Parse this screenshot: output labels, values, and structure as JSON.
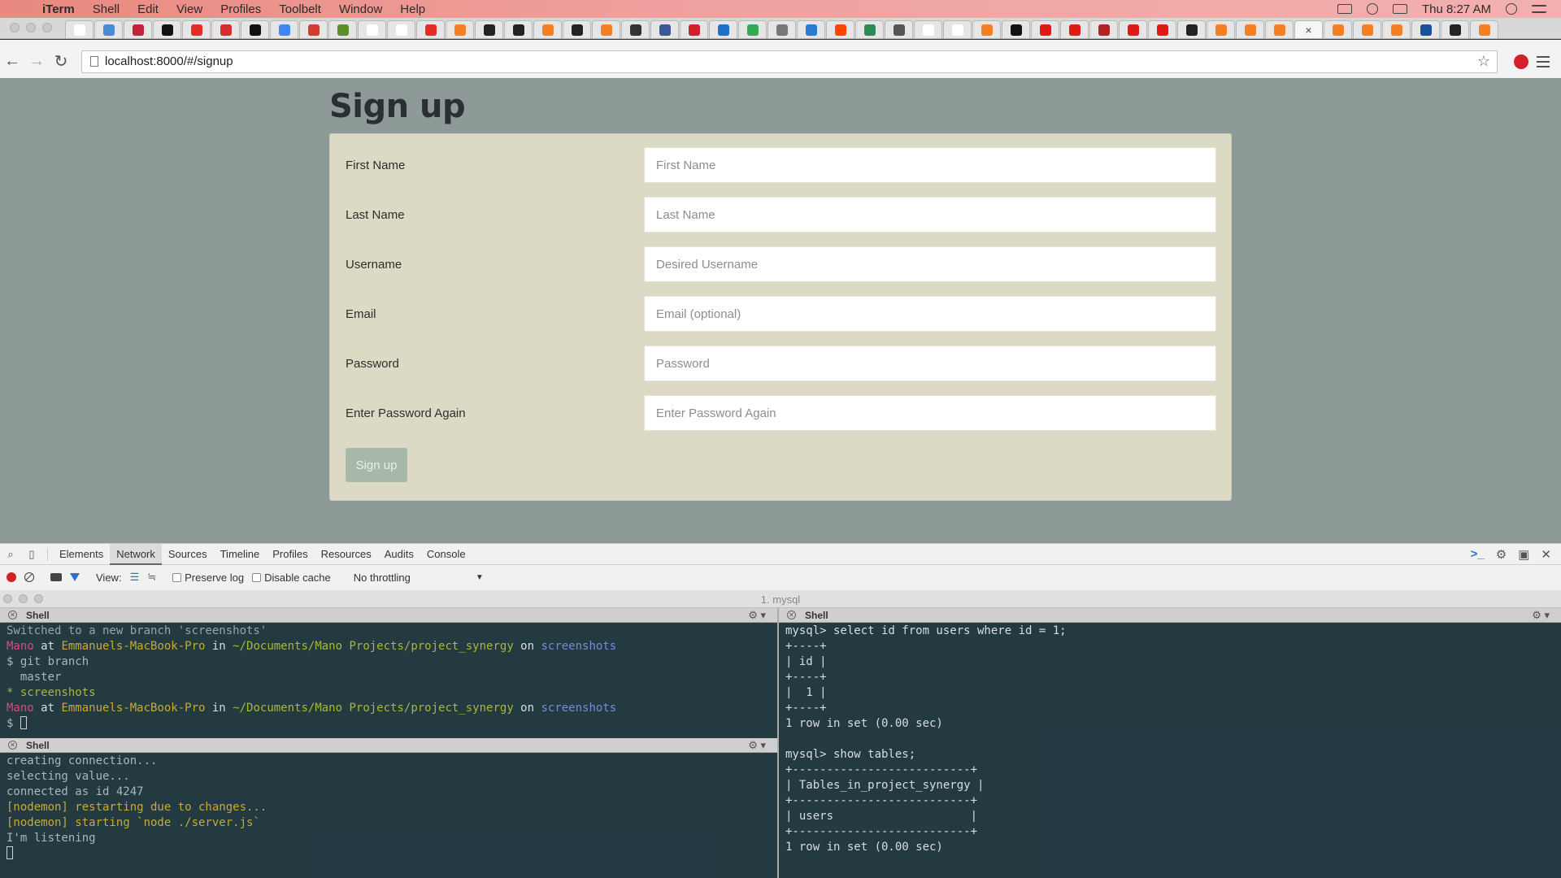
{
  "menubar": {
    "app_name": "iTerm",
    "items": [
      "Shell",
      "Edit",
      "View",
      "Profiles",
      "Toolbelt",
      "Window",
      "Help"
    ],
    "clock": "Thu 8:27 AM"
  },
  "browser": {
    "url": "localhost:8000/#/signup",
    "tab_colors": [
      "#ffffff",
      "#4a8bd6",
      "#c2233a",
      "#111111",
      "#e52d27",
      "#d32f2f",
      "#111111",
      "#4285f4",
      "#d23b2f",
      "#5c8f2c",
      "#ffffff",
      "#ffffff",
      "#e52d27",
      "#f48024",
      "#222222",
      "#222222",
      "#f48024",
      "#222222",
      "#f48024",
      "#333333",
      "#3b5998",
      "#d0202a",
      "#1e70c8",
      "#34a853",
      "#777777",
      "#2a7bd1",
      "#ff4500",
      "#2e8b57",
      "#555555",
      "#ffffff",
      "#ffffff",
      "#f48024",
      "#111111",
      "#dd1b16",
      "#dd1b16",
      "#b22222",
      "#dd1b16",
      "#dd1b16",
      "#222222",
      "#f48024",
      "#f48024",
      "#f48024",
      "#ffffff",
      "#f48024",
      "#f48024",
      "#f48024",
      "#1b4f9c",
      "#222222",
      "#f48024"
    ]
  },
  "signup": {
    "title": "Sign up",
    "fields": [
      {
        "label": "First Name",
        "placeholder": "First Name"
      },
      {
        "label": "Last Name",
        "placeholder": "Last Name"
      },
      {
        "label": "Username",
        "placeholder": "Desired Username"
      },
      {
        "label": "Email",
        "placeholder": "Email (optional)"
      },
      {
        "label": "Password",
        "placeholder": "Password"
      },
      {
        "label": "Enter Password Again",
        "placeholder": "Enter Password Again"
      }
    ],
    "submit_label": "Sign up"
  },
  "devtools": {
    "tabs": [
      "Elements",
      "Network",
      "Sources",
      "Timeline",
      "Profiles",
      "Resources",
      "Audits",
      "Console"
    ],
    "active_tab": "Network",
    "view_label": "View:",
    "preserve_log": "Preserve log",
    "disable_cache": "Disable cache",
    "throttling": "No throttling"
  },
  "iterm": {
    "window_title": "1. mysql",
    "pane_label": "Shell",
    "top_left_lines": [
      [
        {
          "t": "Switched to a new branch 'screenshots'",
          "c": "gray"
        }
      ],
      [
        {
          "t": "Mano",
          "c": "pink"
        },
        {
          "t": " at ",
          "c": "white"
        },
        {
          "t": "Emmanuels-MacBook-Pro",
          "c": "yellow"
        },
        {
          "t": " in ",
          "c": "white"
        },
        {
          "t": "~/Documents/Mano Projects/project_synergy",
          "c": "green"
        },
        {
          "t": " on ",
          "c": "white"
        },
        {
          "t": "screenshots",
          "c": "blue"
        }
      ],
      [
        {
          "t": "$ git branch",
          "c": "out"
        }
      ],
      [
        {
          "t": "  master",
          "c": "out"
        }
      ],
      [
        {
          "t": "* screenshots",
          "c": "green"
        }
      ],
      [
        {
          "t": "Mano",
          "c": "pink"
        },
        {
          "t": " at ",
          "c": "white"
        },
        {
          "t": "Emmanuels-MacBook-Pro",
          "c": "yellow"
        },
        {
          "t": " in ",
          "c": "white"
        },
        {
          "t": "~/Documents/Mano Projects/project_synergy",
          "c": "green"
        },
        {
          "t": " on ",
          "c": "white"
        },
        {
          "t": "screenshots",
          "c": "blue"
        }
      ],
      [
        {
          "t": "$ ",
          "c": "out"
        },
        {
          "cursor": true
        }
      ]
    ],
    "bottom_left_lines": [
      [
        {
          "t": "creating connection...",
          "c": "out"
        }
      ],
      [
        {
          "t": "selecting value...",
          "c": "out"
        }
      ],
      [
        {
          "t": "connected as id 4247",
          "c": "out"
        }
      ],
      [
        {
          "t": "[nodemon] restarting due to changes...",
          "c": "yellow"
        }
      ],
      [
        {
          "t": "[nodemon] starting `node ./server.js`",
          "c": "yellow"
        }
      ],
      [
        {
          "t": "I'm listening",
          "c": "out"
        }
      ],
      [
        {
          "cursor": true
        }
      ]
    ],
    "right_lines": [
      [
        {
          "t": "mysql> select id from users where id = 1;",
          "c": "white"
        }
      ],
      [
        {
          "t": "+----+",
          "c": "white"
        }
      ],
      [
        {
          "t": "| id |",
          "c": "white"
        }
      ],
      [
        {
          "t": "+----+",
          "c": "white"
        }
      ],
      [
        {
          "t": "|  1 |",
          "c": "white"
        }
      ],
      [
        {
          "t": "+----+",
          "c": "white"
        }
      ],
      [
        {
          "t": "1 row in set (0.00 sec)",
          "c": "white"
        }
      ],
      [
        {
          "t": "",
          "c": "white"
        }
      ],
      [
        {
          "t": "mysql> show tables;",
          "c": "white"
        }
      ],
      [
        {
          "t": "+--------------------------+",
          "c": "white"
        }
      ],
      [
        {
          "t": "| Tables_in_project_synergy |",
          "c": "white"
        }
      ],
      [
        {
          "t": "+--------------------------+",
          "c": "white"
        }
      ],
      [
        {
          "t": "| users                    |",
          "c": "white"
        }
      ],
      [
        {
          "t": "+--------------------------+",
          "c": "white"
        }
      ],
      [
        {
          "t": "1 row in set (0.00 sec)",
          "c": "white"
        }
      ]
    ]
  }
}
